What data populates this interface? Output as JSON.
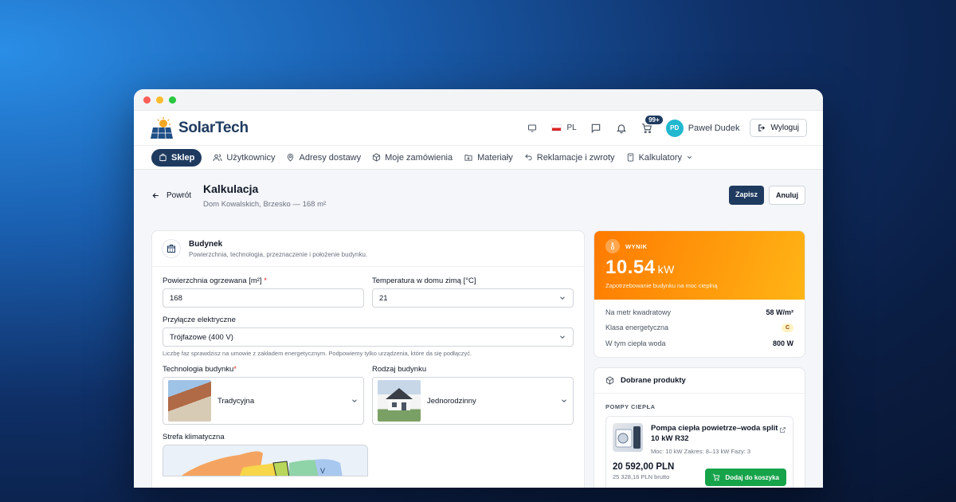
{
  "app": {
    "name": "SolarTech"
  },
  "topbar": {
    "lang": "PL",
    "cart_badge": "99+",
    "user_initials": "PD",
    "user_name": "Paweł Dudek",
    "logout_label": "Wyloguj"
  },
  "nav": {
    "items": [
      {
        "label": "Sklep",
        "active": true
      },
      {
        "label": "Użytkownicy"
      },
      {
        "label": "Adresy dostawy"
      },
      {
        "label": "Moje zamówienia"
      },
      {
        "label": "Materiały"
      },
      {
        "label": "Reklamacje i zwroty"
      },
      {
        "label": "Kalkulatory"
      }
    ]
  },
  "page": {
    "back_label": "Powrót",
    "title": "Kalkulacja",
    "subtitle": "Dom Kowalskich, Brzesko — 168 m²",
    "save_label": "Zapisz",
    "cancel_label": "Anuluj"
  },
  "building": {
    "title": "Budynek",
    "subtitle": "Powierzchnia, technologia, przeznaczenie i położenie budynku.",
    "area_label": "Powierzchnia ogrzewana [m²]",
    "area_value": "168",
    "temp_label": "Temperatura w domu zimą [°C]",
    "temp_value": "21",
    "connection_label": "Przyłącze elektryczne",
    "connection_value": "Trójfazowe (400 V)",
    "connection_hint": "Liczbę faz sprawdzisz na umowie z zakładem energetycznym. Podpowiemy tylko urządzenia, które da się podłączyć.",
    "tech_label": "Technologia budynku",
    "tech_value": "Tradycyjna",
    "type_label": "Rodzaj budynku",
    "type_value": "Jednorodzinny",
    "zone_label": "Strefa klimatyczna",
    "zone_marker": "V"
  },
  "result": {
    "label": "WYNIK",
    "value": "10.54",
    "unit": "kW",
    "description": "Zapotrzebowanie budynku na moc cieplną",
    "rows": [
      {
        "label": "Na metr kwadratowy",
        "value": "58 W/m²"
      },
      {
        "label": "Klasa energetyczna",
        "value": "C"
      },
      {
        "label": "W tym ciepła woda",
        "value": "800 W"
      }
    ]
  },
  "products": {
    "title": "Dobrane produkty",
    "category": "POMPY CIEPŁA",
    "item": {
      "name": "Pompa ciepła powietrze–woda split 10 kW R32",
      "specs": "Moc: 10 kW   Zakres: 8–13 kW   Fazy: 3",
      "price": "20 592,00 PLN",
      "gross": "25 328,16 PLN brutto",
      "cart_label": "Dodaj do koszyka"
    }
  },
  "colors": {
    "brand": "#1e3a5f",
    "accent": "#ff8a00",
    "success": "#16a34a"
  }
}
